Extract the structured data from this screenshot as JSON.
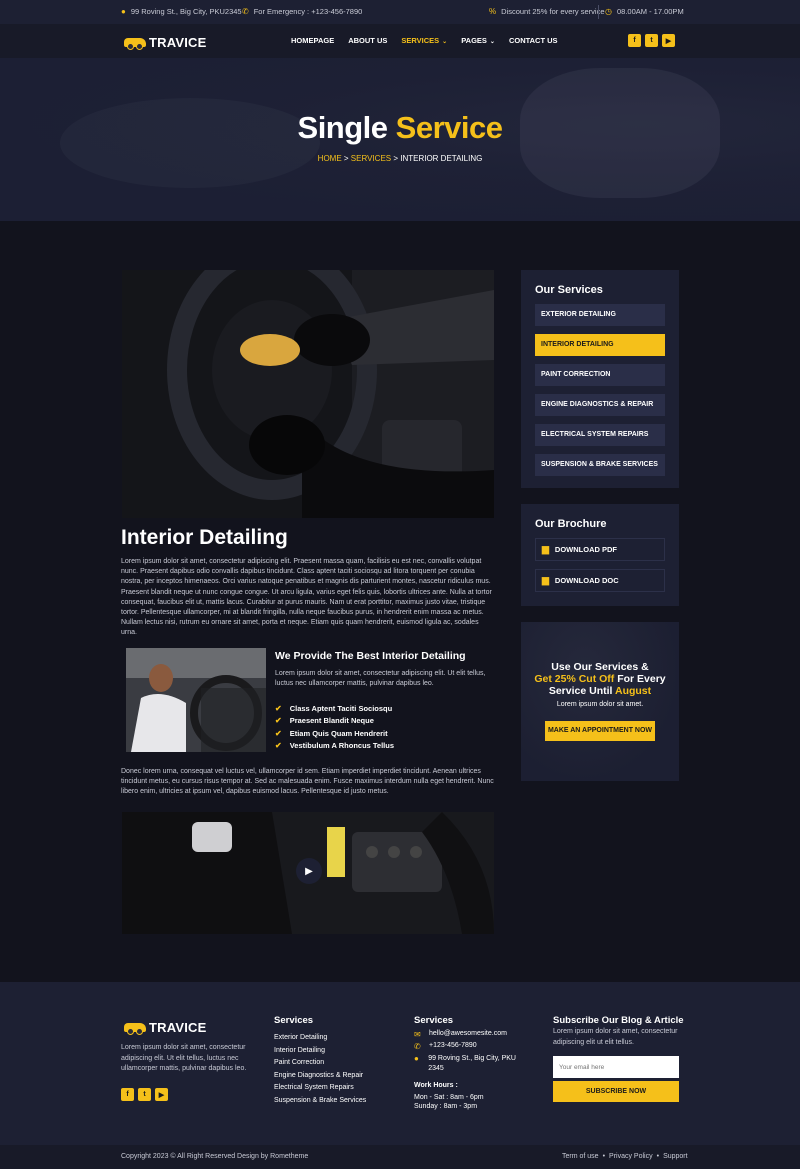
{
  "topbar": {
    "address": "99 Roving St., Big City, PKU2345",
    "emergency": "For Emergency : +123-456-7890",
    "discount": "Discount 25% for every service",
    "hours": "08.00AM - 17.00PM"
  },
  "brand": {
    "name": "TRAVICE"
  },
  "nav": {
    "items": [
      "HOMEPAGE",
      "ABOUT US",
      "SERVICES",
      "PAGES",
      "CONTACT US"
    ],
    "active": "SERVICES"
  },
  "social": [
    "f",
    "t",
    "▶"
  ],
  "hero": {
    "title_white": "Single",
    "title_yellow": "Service",
    "crumb_home": "HOME",
    "crumb_services": "SERVICES",
    "crumb_current": "INTERIOR DETAILING",
    "crumb_sep": " > "
  },
  "content": {
    "title": "Interior Detailing",
    "para1": "Lorem ipsum dolor sit amet, consectetur adipiscing elit. Praesent massa quam, facilisis eu est nec, convallis volutpat nunc. Praesent dapibus odio convallis dapibus tincidunt. Class aptent taciti sociosqu ad litora torquent per conubia nostra, per inceptos himenaeos. Orci varius natoque penatibus et magnis dis parturient montes, nascetur ridiculus mus. Praesent blandit neque ut nunc congue congue. Ut arcu ligula, varius eget felis quis, lobortis ultrices ante. Nulla at tortor consequat, faucibus elit ut, mattis lacus. Curabitur at purus mauris. Nam ut erat porttitor, maximus justo vitae, tristique tortor. Pellentesque ullamcorper, mi at blandit fringilla, nulla neque faucibus purus, in hendrerit enim massa ac metus. Nullam lectus nisi, rutrum eu ornare sit amet, porta et neque. Etiam quis quam hendrerit, euismod ligula ac, sodales urna.",
    "sub_title": "We Provide The Best Interior Detailing",
    "sub_text": "Lorem ipsum dolor sit amet, consectetur adipiscing elit. Ut elit tellus, luctus nec ullamcorper mattis, pulvinar dapibus leo.",
    "checks": [
      "Class Aptent Taciti Sociosqu",
      "Praesent Blandit Neque",
      "Etiam Quis Quam Hendrerit",
      "Vestibulum A Rhoncus Tellus"
    ],
    "para2": "Donec lorem urna, consequat vel luctus vel, ullamcorper id sem. Etiam imperdiet imperdiet tincidunt. Aenean ultrices tincidunt metus, eu cursus risus tempor at. Sed ac malesuada enim. Fusce maximus interdum nulla eget hendrerit. Nunc libero enim, ultricies at ipsum vel, dapibus euismod lacus. Pellentesque id justo metus."
  },
  "sidebar": {
    "services_title": "Our Services",
    "services": [
      "EXTERIOR DETAILING",
      "INTERIOR DETAILING",
      "PAINT CORRECTION",
      "ENGINE DIAGNOSTICS & REPAIR",
      "ELECTRICAL SYSTEM REPAIRS",
      "SUSPENSION & BRAKE SERVICES"
    ],
    "active_service": "INTERIOR DETAILING",
    "brochure_title": "Our Brochure",
    "downloads": [
      "DOWNLOAD PDF",
      "DOWNLOAD DOC"
    ],
    "promo": {
      "line1": "Use Our Services &",
      "line2": "Get 25% Cut Off",
      "line2b": " For Every",
      "line3": "Service Until ",
      "line3b": "August",
      "sub": "Lorem ipsum dolor sit amet.",
      "button": "MAKE AN APPOINTMENT NOW"
    }
  },
  "footer": {
    "about": "Lorem ipsum dolor sit amet, consectetur adipiscing elit. Ut elit tellus, luctus nec ullamcorper mattis, pulvinar dapibus leo.",
    "services_title": "Services",
    "services": [
      "Exterior Detailing",
      "Interior Detailing",
      "Paint Correction",
      "Engine Diagnostics & Repair",
      "Electrical System Repairs",
      "Suspension & Brake Services"
    ],
    "contact_title": "Services",
    "email": "hello@awesomesite.com",
    "phone": "+123-456-7890",
    "address": "99 Roving St., Big City, PKU 2345",
    "hours_title": "Work Hours :",
    "hours1": "Mon - Sat : 8am - 6pm",
    "hours2": "Sunday : 8am - 3pm",
    "subscribe_title": "Subscribe Our Blog & Article",
    "subscribe_text": "Lorem ipsum dolor sit amet, consectetur adipiscing elit ut elit tellus.",
    "email_placeholder": "Your email here",
    "subscribe_button": "SUBSCRIBE NOW"
  },
  "bottom": {
    "copyright": "Copyright 2023 © All Right Reserved Design by Rometheme",
    "links": [
      "Term of use",
      "Privacy Policy",
      "Support"
    ]
  },
  "colors": {
    "accent": "#f5c01a",
    "dark": "#12131d",
    "panel": "#1d2033"
  }
}
